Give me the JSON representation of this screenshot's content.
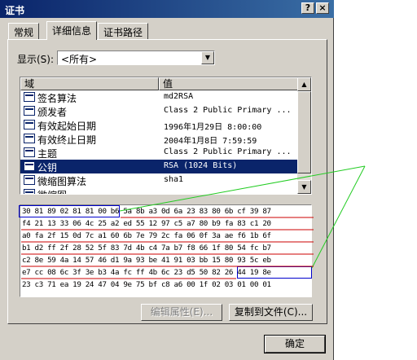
{
  "window": {
    "title": "证书",
    "help_button": "?",
    "close_button": "×"
  },
  "tabs": [
    {
      "label": "常规"
    },
    {
      "label": "详细信息"
    },
    {
      "label": "证书路径"
    }
  ],
  "show": {
    "label": "显示(S):",
    "selected": "<所有>"
  },
  "list": {
    "columns": [
      "域",
      "值"
    ],
    "rows": [
      {
        "field": "签名算法",
        "value": "md2RSA",
        "selected": false
      },
      {
        "field": "颁发者",
        "value": "Class 2 Public Primary ...",
        "selected": false
      },
      {
        "field": "有效起始日期",
        "value": "1996年1月29日 8:00:00",
        "selected": false
      },
      {
        "field": "有效终止日期",
        "value": "2004年1月8日 7:59:59",
        "selected": false
      },
      {
        "field": "主题",
        "value": "Class 2 Public Primary ...",
        "selected": false
      },
      {
        "field": "公钥",
        "value": "RSA (1024 Bits)",
        "selected": true
      },
      {
        "field": "微缩图算法",
        "value": "sha1",
        "selected": false
      },
      {
        "field": "微缩图",
        "value": "...",
        "selected": false
      }
    ]
  },
  "hex_lines": [
    "30 81 89 02 81 81 00 b6 5a 8b a3 0d 6a 23 83 80 6b cf 39 87",
    "f4 21 13 33 06 4c 25 a2 ed 55 12 97 c5 a7 80 b9 fa 83 c1 20",
    "a0 fa 2f 15 0d 7c a1 60 6b 7e 79 2c fa 06 0f 3a ae f6 1b 6f",
    "b1 d2 ff 2f 28 52 5f 83 7d 4b c4 7a b7 f8 66 1f 80 54 fc b7",
    "c2 8e 59 4a 14 57 46 d1 9a 93 be 41 91 03 bb 15 80 93 5c eb",
    "e7 cc 08 6c 3f 3e b3 4a fc ff 4b 6c 23 d5 50 82 26 44 19 8e",
    "23 c3 71 ea 19 24 47 04 9e 75 bf c8 a6 00 1f 02 03 01 00 01"
  ],
  "buttons": {
    "edit_properties": "编辑属性(E)...",
    "copy_to_file": "复制到文件(C)...",
    "ok": "确定"
  },
  "colors": {
    "titlebar": "#0a246a",
    "selection": "#0a246a",
    "annotation_line": "#22cc22",
    "annotation_box": "#0000cc",
    "annotation_underline": "#cc0000"
  }
}
